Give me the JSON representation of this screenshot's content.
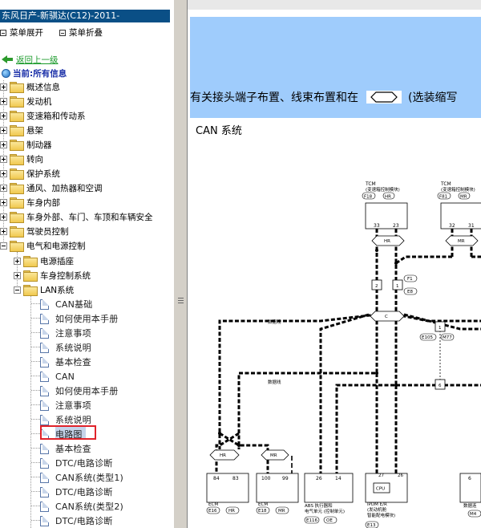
{
  "window_title": "东风日产-新骐达(C12)-2011-",
  "menu": {
    "expand_label": "菜单展开",
    "collapse_label": "菜单折叠"
  },
  "nav": {
    "back_label": "返回上一级",
    "current_label": "当前:所有信息"
  },
  "tree": {
    "top_items": [
      "概述信息",
      "发动机",
      "变速箱和传动系",
      "悬架",
      "制动器",
      "转向",
      "保护系统",
      "通风、加热器和空调",
      "车身内部",
      "车身外部、车门、车顶和车辆安全",
      "驾驶员控制",
      "电气和电源控制"
    ],
    "sub_items": [
      "电源插座",
      "车身控制系统",
      "LAN系统"
    ],
    "docs": [
      "CAN基础",
      "如何使用本手册",
      "注意事项",
      "系统说明",
      "基本检查",
      "CAN",
      "如何使用本手册",
      "注意事项",
      "系统说明",
      "电路图",
      "基本检查",
      "DTC/电路诊断",
      "CAN系统(类型1)",
      "DTC/电路诊断",
      "CAN系统(类型2)",
      "DTC/电路诊断"
    ],
    "selected": "电路图"
  },
  "content": {
    "banner_text_before": "有关接头端子布置、线束布置和在",
    "banner_text_after": "(选装缩写",
    "section_title": "CAN 系统"
  },
  "diagram": {
    "tcm1": {
      "title": "TCM",
      "subtitle": "(变速箱控制模块)",
      "conn": "F18",
      "tag": "HR",
      "pins": [
        "33",
        "23"
      ]
    },
    "tcm2": {
      "title": "TCM",
      "subtitle": "(变速箱控制模块)",
      "conn": "F81",
      "tag": "MR",
      "pins": [
        "32",
        "31"
      ]
    },
    "joint_hr": "HR",
    "joint_mr": "MR",
    "junction_c": "C",
    "jc1": {
      "a": "2",
      "b": "1",
      "conn1": "F1",
      "conn2": "E8"
    },
    "jc2": {
      "n": "1",
      "conn1": "E105",
      "conn2": "M77",
      "n2": "6"
    },
    "data_line_label": "数据线",
    "ecm1": {
      "title": "ECM",
      "conn": "E16",
      "tag": "HR",
      "pins": [
        "84",
        "83"
      ]
    },
    "ecm2": {
      "title": "ECM",
      "conn": "E18",
      "tag": "MR",
      "pins": [
        "100",
        "99"
      ]
    },
    "abs": {
      "title": "ABS 执行器和",
      "title2": "电气单元 (控制单元)",
      "conn": "E116",
      "tag": "OE",
      "pins": [
        "26",
        "14"
      ]
    },
    "ipdm": {
      "title": "IPDM E/R",
      "title2": "(发动机舱",
      "title3": "智能配电模块)",
      "conn": "E13",
      "cpu": "CPU",
      "pins": [
        "27",
        "26"
      ]
    },
    "dlc": {
      "title": "数据连",
      "conn": "M4",
      "pin": "6"
    }
  }
}
